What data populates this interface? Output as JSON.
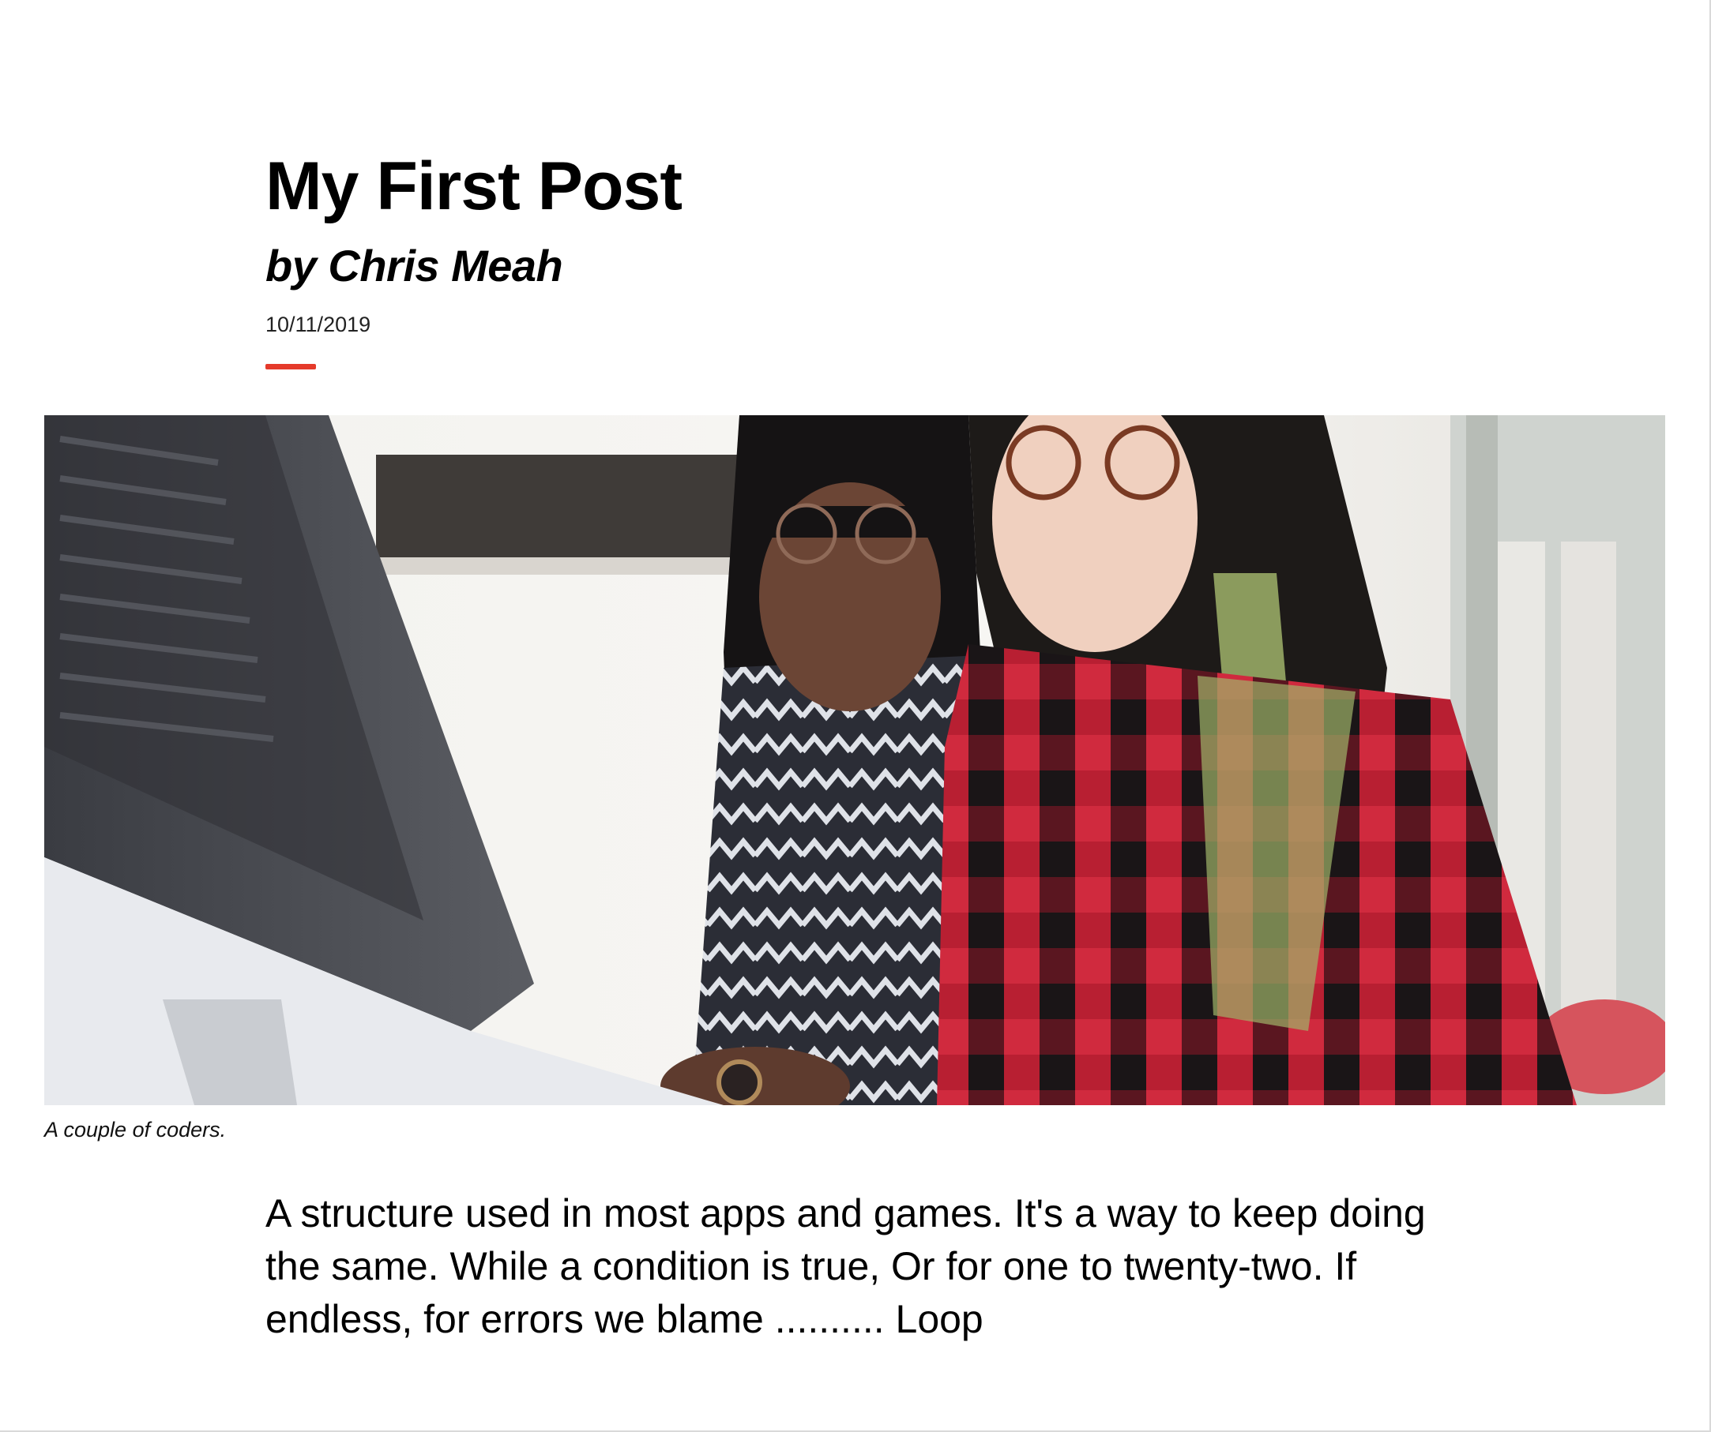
{
  "post": {
    "title": "My First Post",
    "byline": "by Chris Meah",
    "date": "10/11/2019",
    "accent_color": "#e53a2b",
    "image_caption": "A couple of coders.",
    "body": "A structure used in most apps and games. It's a way to keep doing the same. While a condition is true, Or for one to twenty-two. If endless, for errors we blame .......... Loop"
  }
}
